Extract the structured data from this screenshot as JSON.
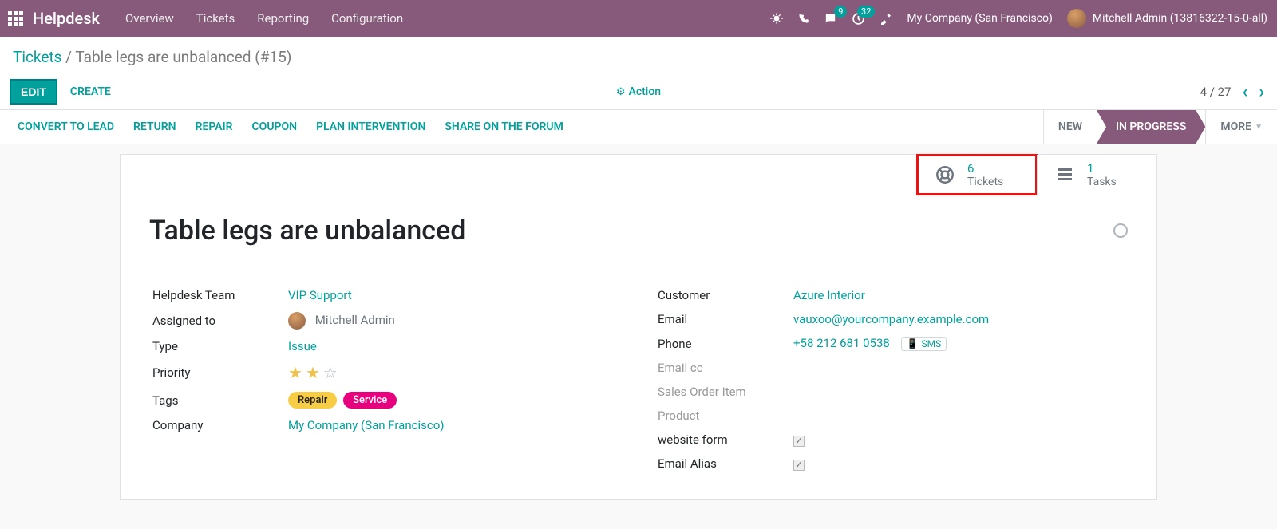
{
  "nav": {
    "brand": "Helpdesk",
    "menu": [
      "Overview",
      "Tickets",
      "Reporting",
      "Configuration"
    ],
    "msg_badge": "9",
    "activity_badge": "32",
    "company": "My Company (San Francisco)",
    "user": "Mitchell Admin (13816322-15-0-all)"
  },
  "breadcrumb": {
    "root": "Tickets",
    "current": "Table legs are unbalanced (#15)"
  },
  "buttons": {
    "edit": "EDIT",
    "create": "CREATE",
    "action": "Action"
  },
  "pager": {
    "text": "4 / 27"
  },
  "toolbar": [
    "CONVERT TO LEAD",
    "RETURN",
    "REPAIR",
    "COUPON",
    "PLAN INTERVENTION",
    "SHARE ON THE FORUM"
  ],
  "status": {
    "new": "NEW",
    "progress": "IN PROGRESS",
    "more": "MORE"
  },
  "stat": {
    "tickets_count": "6",
    "tickets_label": "Tickets",
    "tasks_count": "1",
    "tasks_label": "Tasks"
  },
  "record": {
    "title": "Table legs are unbalanced",
    "labels": {
      "team": "Helpdesk Team",
      "assigned": "Assigned to",
      "type": "Type",
      "priority": "Priority",
      "tags": "Tags",
      "company": "Company",
      "customer": "Customer",
      "email": "Email",
      "phone": "Phone",
      "emailcc": "Email cc",
      "soitem": "Sales Order Item",
      "product": "Product",
      "webform": "website form",
      "alias": "Email Alias"
    },
    "values": {
      "team": "VIP Support",
      "assigned": "Mitchell Admin",
      "type": "Issue",
      "tag1": "Repair",
      "tag2": "Service",
      "company": "My Company (San Francisco)",
      "customer": "Azure Interior",
      "email": "vauxoo@yourcompany.example.com",
      "phone": "+58 212 681 0538",
      "sms": "SMS"
    }
  }
}
